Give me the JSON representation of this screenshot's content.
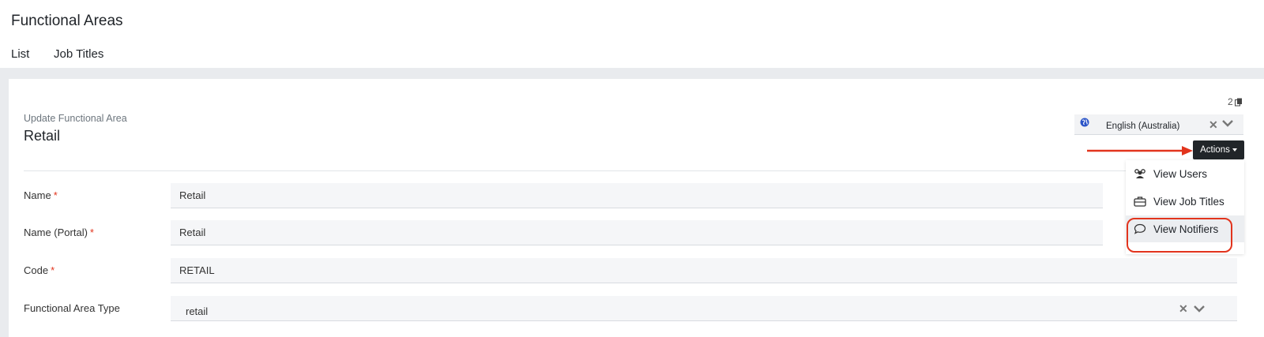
{
  "header": {
    "title": "Functional Areas",
    "tabs": [
      {
        "label": "List"
      },
      {
        "label": "Job Titles"
      }
    ]
  },
  "card": {
    "copy_count": "2",
    "subtitle": "Update Functional Area",
    "title": "Retail"
  },
  "language": {
    "value": "English (Australia)",
    "icon": "globe-icon"
  },
  "actions": {
    "label": "Actions",
    "menu": [
      {
        "label": "View Users",
        "icon": "users-icon"
      },
      {
        "label": "View Job Titles",
        "icon": "briefcase-icon"
      },
      {
        "label": "View Notifiers",
        "icon": "chat-bubble-icon"
      }
    ]
  },
  "form": {
    "fields": [
      {
        "label": "Name",
        "required": true,
        "value": "Retail"
      },
      {
        "label": "Name (Portal)",
        "required": true,
        "value": "Retail"
      },
      {
        "label": "Code",
        "required": true,
        "value": "RETAIL"
      },
      {
        "label": "Functional Area Type",
        "required": false,
        "value": "retail"
      }
    ],
    "required_marker": "*"
  },
  "colors": {
    "accent_dark": "#212529",
    "highlight_red": "#e2341d",
    "background_gray": "#e9ebee"
  }
}
